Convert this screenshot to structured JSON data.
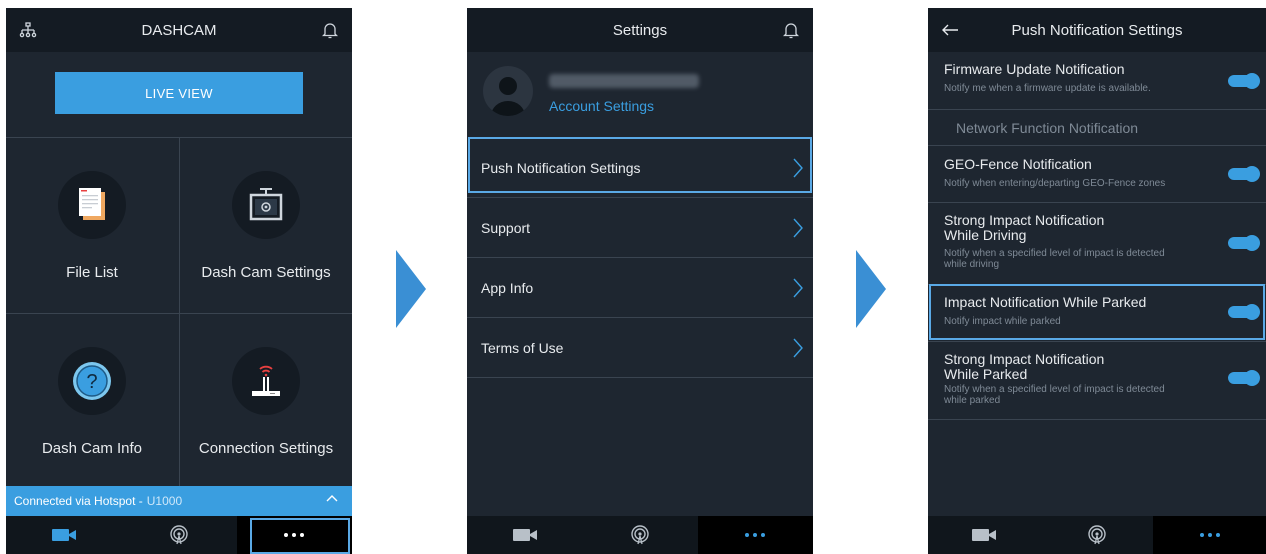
{
  "screen1": {
    "header_title": "DASHCAM",
    "live_view_label": "LIVE VIEW",
    "grid": [
      {
        "label": "File List",
        "icon": "file-list-icon"
      },
      {
        "label": "Dash Cam Settings",
        "icon": "dashcam-settings-icon"
      },
      {
        "label": "Dash Cam Info",
        "icon": "info-question-icon"
      },
      {
        "label": "Connection Settings",
        "icon": "router-icon"
      }
    ],
    "status": {
      "text": "Connected via Hotspot - ",
      "model": "U1000"
    },
    "tabs": [
      "camera-icon",
      "broadcast-icon",
      "more-icon"
    ]
  },
  "screen2": {
    "header_title": "Settings",
    "account_link": "Account Settings",
    "rows": [
      {
        "label": "Push Notification Settings"
      },
      {
        "label": "Support"
      },
      {
        "label": "App Info"
      },
      {
        "label": "Terms of Use"
      }
    ]
  },
  "screen3": {
    "header_title": "Push Notification Settings",
    "section_label": "Network Function Notification",
    "rows": [
      {
        "title": "Firmware Update Notification",
        "desc": "Notify me when a firmware update is available.",
        "enabled": true
      },
      {
        "title": "GEO-Fence Notification",
        "desc": "Notify when entering/departing GEO-Fence zones",
        "enabled": true
      },
      {
        "title": "Strong Impact Notification\nWhile Driving",
        "desc": "Notify when a specified level of impact is detected\nwhile driving",
        "enabled": true
      },
      {
        "title": "Impact Notification While Parked",
        "desc": "Notify impact while parked",
        "enabled": true
      },
      {
        "title": "Strong Impact Notification\nWhile Parked",
        "desc": "Notify when a specified level of impact is detected\nwhile parked",
        "enabled": true
      }
    ]
  },
  "colors": {
    "accent": "#3a9ee0",
    "panel": "#1e2630",
    "header": "#141b23",
    "highlight": "#5aa9e6"
  }
}
